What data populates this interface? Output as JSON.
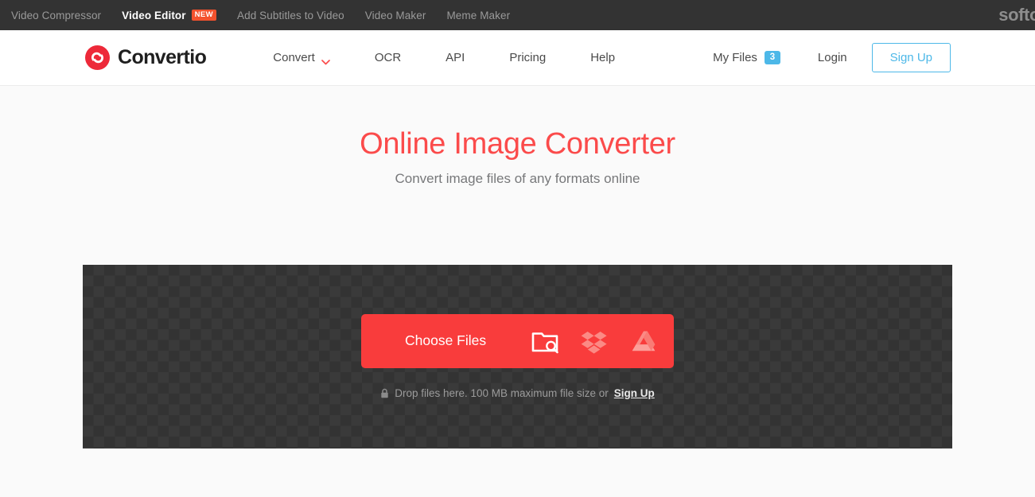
{
  "topbar": {
    "items": [
      {
        "label": "Video Compressor",
        "badge": null,
        "active": false
      },
      {
        "label": "Video Editor",
        "badge": "NEW",
        "active": true
      },
      {
        "label": "Add Subtitles to Video",
        "badge": null,
        "active": false
      },
      {
        "label": "Video Maker",
        "badge": null,
        "active": false
      },
      {
        "label": "Meme Maker",
        "badge": null,
        "active": false
      }
    ],
    "brand_right": "softo"
  },
  "header": {
    "logo_icon": "convertio-logo-icon",
    "brand_name": "Convertio",
    "nav": [
      {
        "label": "Convert",
        "has_dropdown": true
      },
      {
        "label": "OCR",
        "has_dropdown": false
      },
      {
        "label": "API",
        "has_dropdown": false
      },
      {
        "label": "Pricing",
        "has_dropdown": false
      },
      {
        "label": "Help",
        "has_dropdown": false
      }
    ],
    "my_files_label": "My Files",
    "my_files_count": "3",
    "login_label": "Login",
    "signup_label": "Sign Up"
  },
  "hero": {
    "title": "Online Image Converter",
    "subtitle": "Convert image files of any formats online"
  },
  "dropzone": {
    "choose_files_label": "Choose Files",
    "sources": [
      {
        "name": "folder-search-icon"
      },
      {
        "name": "dropbox-icon"
      },
      {
        "name": "google-drive-icon"
      }
    ],
    "hint_lock_icon": "lock-icon",
    "hint_text": "Drop files here. 100 MB maximum file size or",
    "hint_link": "Sign Up"
  },
  "colors": {
    "accent_red": "#fb4b4b",
    "button_red": "#f93c3c",
    "accent_blue": "#4db8e8",
    "topbar_dark": "#333333",
    "new_badge": "#f4522d",
    "page_bg": "#fafafa"
  }
}
